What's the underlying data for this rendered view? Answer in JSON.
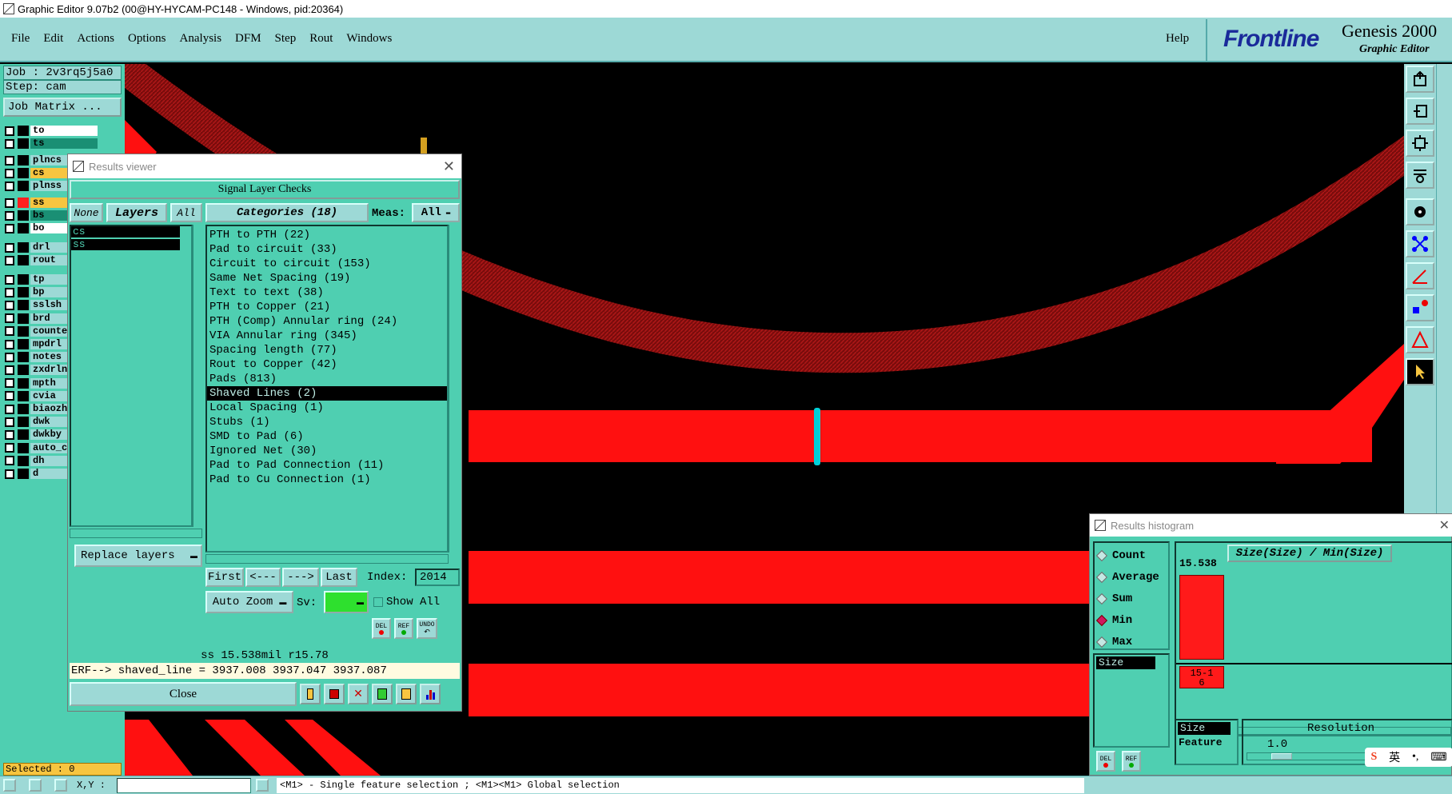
{
  "window": {
    "title": "Graphic Editor 9.07b2 (00@HY-HYCAM-PC148 - Windows, pid:20364)"
  },
  "menu": {
    "items": [
      "File",
      "Edit",
      "Actions",
      "Options",
      "Analysis",
      "DFM",
      "Step",
      "Rout",
      "Windows"
    ],
    "help": "Help"
  },
  "brand": {
    "logo": "Frontline",
    "product": "Genesis 2000",
    "subtitle": "Graphic Editor"
  },
  "job": {
    "job_line": "Job : 2v3rq5j5a0",
    "step_line": "Step: cam",
    "matrix_button": "Job Matrix ..."
  },
  "layers": [
    {
      "name": "to",
      "color": "#ffffff",
      "swatch": "#000000"
    },
    {
      "name": "ts",
      "color": "#1a8f74",
      "swatch": "#000000"
    },
    {
      "name": "plncs",
      "color": "#9dd9d6",
      "swatch": "#000000"
    },
    {
      "name": "cs",
      "color": "#f7c540",
      "swatch": "#000000"
    },
    {
      "name": "plnss",
      "color": "#9dd9d6",
      "swatch": "#000000"
    },
    {
      "name": "ss",
      "color": "#f7c540",
      "swatch": "#ff2020"
    },
    {
      "name": "bs",
      "color": "#1a8f74",
      "swatch": "#000000"
    },
    {
      "name": "bo",
      "color": "#ffffff",
      "swatch": "#000000"
    },
    {
      "name": "drl",
      "color": "#9dd9d6",
      "swatch": "#000000"
    },
    {
      "name": "rout",
      "color": "#9dd9d6",
      "swatch": "#000000"
    },
    {
      "name": "tp",
      "color": "#9dd9d6",
      "swatch": "#000000"
    },
    {
      "name": "bp",
      "color": "#9dd9d6",
      "swatch": "#000000"
    },
    {
      "name": "sslsh",
      "color": "#9dd9d6",
      "swatch": "#000000"
    },
    {
      "name": "brd",
      "color": "#9dd9d6",
      "swatch": "#000000"
    },
    {
      "name": "counte",
      "color": "#9dd9d6",
      "swatch": "#000000"
    },
    {
      "name": "mpdrl",
      "color": "#9dd9d6",
      "swatch": "#000000"
    },
    {
      "name": "notes",
      "color": "#9dd9d6",
      "swatch": "#000000"
    },
    {
      "name": "zxdrln",
      "color": "#9dd9d6",
      "swatch": "#000000"
    },
    {
      "name": "mpth",
      "color": "#9dd9d6",
      "swatch": "#000000"
    },
    {
      "name": "cvia",
      "color": "#9dd9d6",
      "swatch": "#000000"
    },
    {
      "name": "biaozh",
      "color": "#9dd9d6",
      "swatch": "#000000"
    },
    {
      "name": "dwk",
      "color": "#9dd9d6",
      "swatch": "#000000"
    },
    {
      "name": "dwkby",
      "color": "#9dd9d6",
      "swatch": "#000000"
    },
    {
      "name": "auto_c",
      "color": "#9dd9d6",
      "swatch": "#000000"
    },
    {
      "name": "dh",
      "color": "#9dd9d6",
      "swatch": "#000000"
    },
    {
      "name": "d",
      "color": "#9dd9d6",
      "swatch": "#000000"
    }
  ],
  "status": {
    "selected": "Selected : 0",
    "xy_label": "X,Y :",
    "hint": "<M1> - Single feature selection ; <M1><M1> Global selection"
  },
  "results_viewer": {
    "title": "Results viewer",
    "header": "Signal Layer Checks",
    "none_btn": "None",
    "layers_btn": "Layers",
    "all_btn": "All",
    "layer_list": [
      "cs",
      "ss"
    ],
    "categories_btn": "Categories (18)",
    "meas_label": "Meas:",
    "meas_value": "All",
    "categories": [
      "PTH to PTH (22)",
      "Pad to circuit (33)",
      "Circuit to circuit (153)",
      "Same Net Spacing (19)",
      "Text to text (38)",
      "PTH to Copper (21)",
      "PTH (Comp) Annular ring (24)",
      "VIA Annular ring (345)",
      "Spacing length (77)",
      "Rout to Copper (42)",
      "Pads (813)",
      "Shaved Lines (2)",
      "Local Spacing (1)",
      "Stubs (1)",
      "SMD to Pad (6)",
      "Ignored Net (30)",
      "Pad to Pad Connection (11)",
      "Pad to Cu Connection (1)"
    ],
    "selected_category": "Shaved Lines (2)",
    "first_btn": "First",
    "prev_btn": "<---",
    "next_btn": "--->",
    "last_btn": "Last",
    "index_label": "Index:",
    "index_value": "2014",
    "autozoom": "Auto Zoom",
    "sv_label": "Sv:",
    "show_all": "Show All",
    "replace_layers": "Replace layers",
    "del": "DEL",
    "ref": "REF",
    "und": "UNDO",
    "measure": "ss 15.538mil  r15.78",
    "erf": "ERF--> shaved_line = 3937.008 3937.047 3937.087",
    "close": "Close"
  },
  "histogram": {
    "title": "Results histogram",
    "options": [
      "Count",
      "Average",
      "Sum",
      "Min",
      "Max"
    ],
    "selected_option": "Min",
    "attr_list": [
      "Size"
    ],
    "chart_title": "Size(Size) / Min(Size)",
    "bar_value": "15.538",
    "bar_label": "15-16",
    "bar_fraction": 1.0,
    "axis_items": [
      "Size",
      "Feature"
    ],
    "resolution_label": "Resolution",
    "resolution_value": "1.0",
    "del": "DEL",
    "ref": "REF"
  },
  "ime": {
    "char": "英"
  },
  "colors": {
    "copper": "#ff1010",
    "hatch": "#8a1010",
    "accent": "#00d0d8",
    "panel": "#4fcfb1",
    "panel_light": "#9dd9d6"
  }
}
